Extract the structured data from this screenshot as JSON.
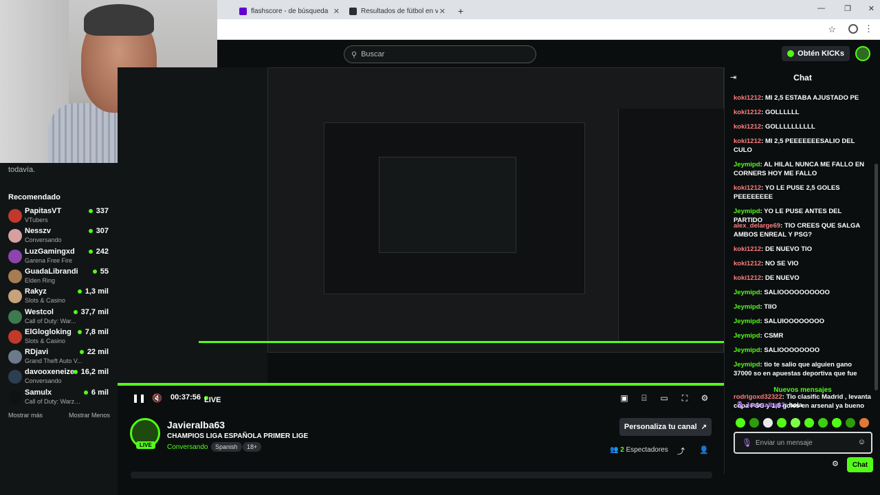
{
  "browser": {
    "tabs": [
      {
        "label": "flashscore - de búsqueda",
        "icon": "yahoo-icon",
        "color": "#6001d2"
      },
      {
        "label": "Resultados de fútbol en vivo, M",
        "icon": "flashscore-icon",
        "color": "#2b2f33"
      }
    ],
    "new_tab_label": "+"
  },
  "header": {
    "search_placeholder": "Buscar",
    "kicks_button": "Obtén KICKs"
  },
  "sidebar": {
    "note": "todavía.",
    "recommended_title": "Recomendado",
    "items": [
      {
        "name": "PapitasVT",
        "category": "VTubers",
        "viewers": "337",
        "color": "#c0392b"
      },
      {
        "name": "Nesszv",
        "category": "Conversando",
        "viewers": "307",
        "color": "#d6a0a0"
      },
      {
        "name": "LuzGamingxd",
        "category": "Garena Free Fire",
        "viewers": "242",
        "color": "#8e44ad"
      },
      {
        "name": "GuadaLibrandi",
        "category": "Elden Ring",
        "viewers": "55",
        "color": "#a67c52"
      },
      {
        "name": "Rakyz",
        "category": "Slots & Casino",
        "viewers": "1,3 mil",
        "color": "#c8a27a"
      },
      {
        "name": "Westcol",
        "category": "Call of Duty: War...",
        "viewers": "37,7 mil",
        "color": "#3d7a4f"
      },
      {
        "name": "ElGlogloking",
        "category": "Slots & Casino",
        "viewers": "7,8 mil",
        "color": "#c0392b"
      },
      {
        "name": "RDjavi",
        "category": "Grand Theft Auto V...",
        "viewers": "22 mil",
        "color": "#6c7a89"
      },
      {
        "name": "davooxeneize",
        "category": "Conversando",
        "viewers": "16,2 mil",
        "color": "#2c3e50"
      },
      {
        "name": "Samulx",
        "category": "Call of Duty: Warzone",
        "viewers": "6 mil",
        "color": "#111111"
      }
    ],
    "show_more": "Mostrar más",
    "show_less": "Mostrar Menos"
  },
  "player": {
    "time": "00:37:56",
    "live_label": "LIVE"
  },
  "stream": {
    "channel": "Javieralba63",
    "title": "CHAMPIOS LIGA ESPAÑOLA PRIMER LIGE",
    "category": "Conversando",
    "tags": [
      "Spanish",
      "18+"
    ],
    "live_badge": "LIVE",
    "customize_button": "Personaliza tu canal",
    "viewers_count": "2",
    "viewers_label": "Espectadores"
  },
  "chat": {
    "title": "Chat",
    "messages": [
      {
        "user": "koki1212",
        "text": "MI 2,5 ESTABA AJUSTADO PE",
        "color": "#ff7d7d"
      },
      {
        "user": "koki1212",
        "text": "GOLLLLLL",
        "color": "#ff7d7d"
      },
      {
        "user": "koki1212",
        "text": "GOLLLLLLLLLL",
        "color": "#ff7d7d"
      },
      {
        "user": "koki1212",
        "text": "MI 2,5 PEEEEEEESALIO DEL CULO",
        "color": "#ff7d7d"
      },
      {
        "user": "Jeymipd",
        "text": "AL HILAL NUNCA ME FALLO EN CORNERS HOY ME FALLO",
        "color": "#53fc18"
      },
      {
        "user": "koki1212",
        "text": "YO LE PUSE 2,5 GOLES PEEEEEEEE",
        "color": "#ff7d7d"
      },
      {
        "user": "Jeymipd",
        "text": "YO LE PUSE ANTES DEL PARTIDO",
        "color": "#53fc18"
      },
      {
        "user": "alex_delarge69",
        "text": "TIO CREES QUE SALGA AMBOS ENREAL Y PSG?",
        "color": "#ff7d7d"
      },
      {
        "user": "koki1212",
        "text": "DE NUEVO TIO",
        "color": "#ff7d7d"
      },
      {
        "user": "koki1212",
        "text": "NO SE VIO",
        "color": "#ff7d7d"
      },
      {
        "user": "koki1212",
        "text": "DE NUEVO",
        "color": "#ff7d7d"
      },
      {
        "user": "Jeymipd",
        "text": "SALIOOOOOOOOOO",
        "color": "#53fc18"
      },
      {
        "user": "Jeymipd",
        "text": "TIIO",
        "color": "#53fc18"
      },
      {
        "user": "Jeymipd",
        "text": "SALUIOOOOOOOO",
        "color": "#53fc18"
      },
      {
        "user": "Jeymipd",
        "text": "CSMR",
        "color": "#53fc18"
      },
      {
        "user": "Jeymipd",
        "text": "SALIOOOOOOOO",
        "color": "#53fc18"
      },
      {
        "user": "Jeymipd",
        "text": "tio te salio que alguien gano 37000 so en apuestas deportiva que fue",
        "color": "#53fc18"
      },
      {
        "user": "rodrigoxd32322",
        "text": "Tio clasific Madrid , levanta copa PSG y 1,5 goles en arsenal ya bueno",
        "color": "#ff7d7d"
      }
    ],
    "new_messages_label": "Nuevos mensajes",
    "pinned_user": "Javieralba63",
    "pinned_text": "hola",
    "input_placeholder": "Enviar un mensaje",
    "send_button": "Chat"
  }
}
